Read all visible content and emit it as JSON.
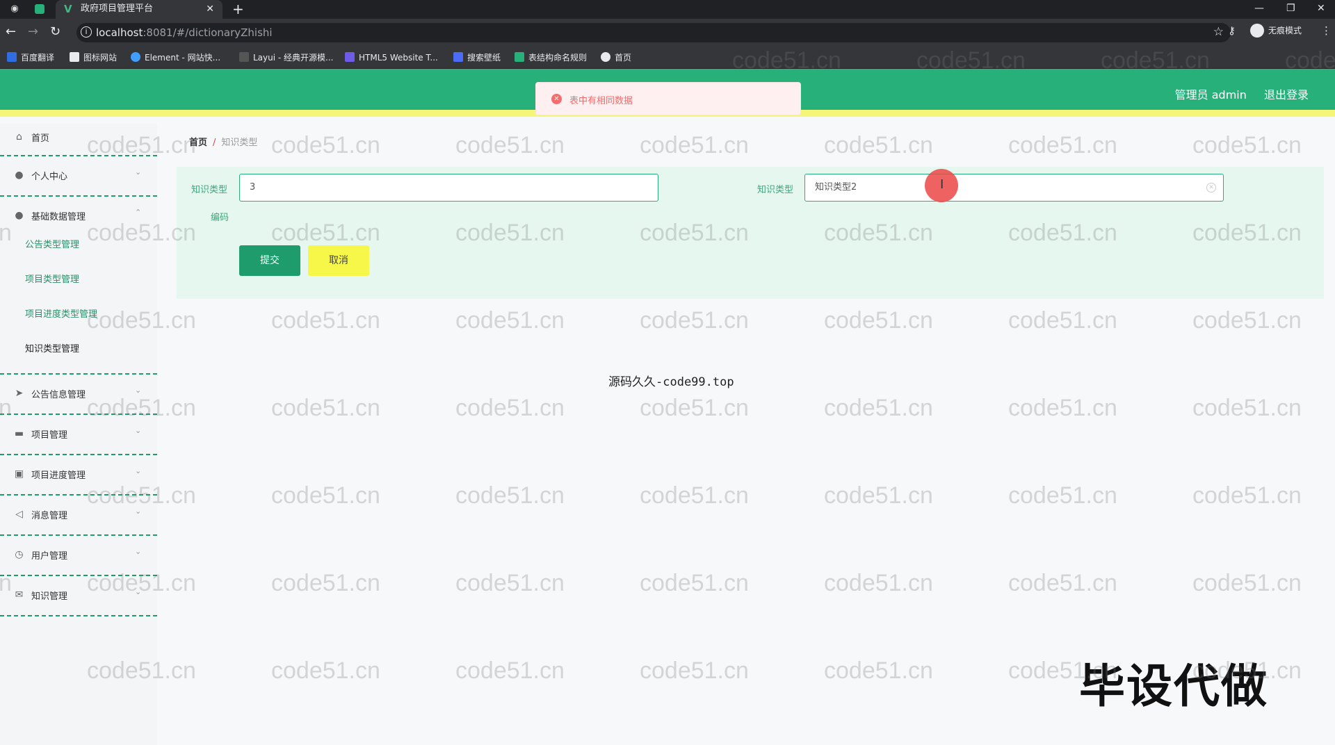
{
  "browser": {
    "tab_title": "政府项目管理平台",
    "url_host": "localhost",
    "url_path": ":8081/#/dictionaryZhishi",
    "incognito_label": "无痕模式",
    "bookmarks": [
      {
        "label": "百度翻译",
        "color": "#2f6de1"
      },
      {
        "label": "图标网站",
        "color": "#e8eaed"
      },
      {
        "label": "Element - 网站快...",
        "color": "#409eff"
      },
      {
        "label": "Layui - 经典开源模...",
        "color": "#e8eaed"
      },
      {
        "label": "HTML5 Website T...",
        "color": "#6c5ce7"
      },
      {
        "label": "搜索壁纸",
        "color": "#4a6cf7"
      },
      {
        "label": "表结构命名规则",
        "color": "#27b07a"
      },
      {
        "label": "首页",
        "color": "#e8eaed"
      }
    ]
  },
  "header": {
    "user_label": "管理员 admin",
    "logout_label": "退出登录",
    "accent_color": "#27b07a"
  },
  "alert": {
    "message": "表中有相同数据",
    "type": "error"
  },
  "sidebar": {
    "items": [
      {
        "label": "首页",
        "icon": "home-icon"
      },
      {
        "label": "个人中心",
        "icon": "user-icon"
      },
      {
        "label": "基础数据管理",
        "icon": "user-icon"
      },
      {
        "label": "公告信息管理",
        "icon": "send-icon"
      },
      {
        "label": "项目管理",
        "icon": "chat-icon"
      },
      {
        "label": "项目进度管理",
        "icon": "clipboard-icon"
      },
      {
        "label": "消息管理",
        "icon": "navigation-icon"
      },
      {
        "label": "用户管理",
        "icon": "clock-icon"
      },
      {
        "label": "知识管理",
        "icon": "mail-icon"
      }
    ],
    "sub_items": [
      {
        "label": "公告类型管理"
      },
      {
        "label": "项目类型管理"
      },
      {
        "label": "项目进度类型管理"
      },
      {
        "label": "知识类型管理"
      }
    ]
  },
  "breadcrumb": {
    "home": "首页",
    "separator": "/",
    "current": "知识类型"
  },
  "form": {
    "code_label_line1": "知识类型",
    "code_label_line2": "编码",
    "code_value": "3",
    "name_label": "知识类型",
    "name_value": "知识类型2",
    "submit_label": "提交",
    "cancel_label": "取消"
  },
  "overlay": {
    "center_text": "源码久久-code99.top",
    "promo_text": "毕设代做",
    "watermark": "code51.cn"
  }
}
